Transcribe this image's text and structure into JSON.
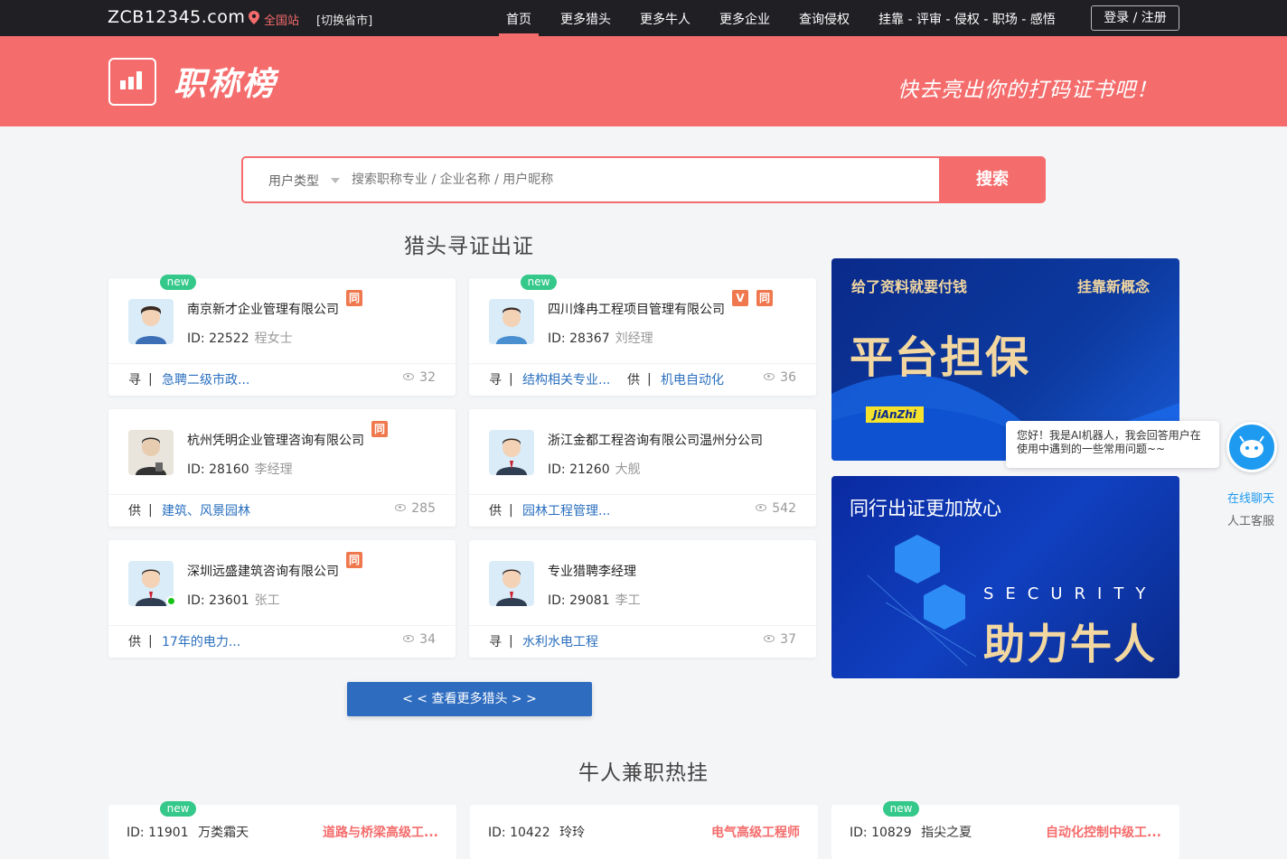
{
  "header": {
    "site_name": "ZCB12345.com",
    "location": "全国站",
    "switch_label": "[切换省市]",
    "nav": [
      "首页",
      "更多猎头",
      "更多牛人",
      "更多企业",
      "查询侵权",
      "挂靠 - 评审 - 侵权 - 职场 - 感悟"
    ],
    "login_label": "登录 / 注册"
  },
  "banner": {
    "logo_text": "职称榜",
    "slogan": "快去亮出你的打码证书吧！"
  },
  "search": {
    "user_type_label": "用户类型",
    "placeholder": "搜索职称专业 / 企业名称 / 用户昵称",
    "button_label": "搜索"
  },
  "headhunter_section": {
    "title": "猎头寻证出证",
    "cards": [
      {
        "company": "南京新才企业管理有限公司",
        "id": "ID: 22522",
        "name": "程女士",
        "new": "new",
        "tags": [
          "同"
        ],
        "f1_type": "寻",
        "f1_text": "急聘二级市政...",
        "f2_type": "",
        "f2_text": "",
        "views": "32"
      },
      {
        "company": "四川烽冉工程项目管理有限公司",
        "id": "ID: 28367",
        "name": "刘经理",
        "new": "new",
        "tags": [
          "V",
          "同"
        ],
        "f1_type": "寻",
        "f1_text": "结构相关专业...",
        "f2_type": "供",
        "f2_text": "机电自动化",
        "views": "36"
      },
      {
        "company": "杭州凭明企业管理咨询有限公司",
        "id": "ID: 28160",
        "name": "李经理",
        "new": "",
        "tags": [
          "同"
        ],
        "f1_type": "供",
        "f1_text": "建筑、风景园林",
        "f2_type": "",
        "f2_text": "",
        "views": "285"
      },
      {
        "company": "浙江金都工程咨询有限公司温州分公司",
        "id": "ID: 21260",
        "name": "大舰",
        "new": "",
        "tags": [],
        "f1_type": "供",
        "f1_text": "园林工程管理...",
        "f2_type": "",
        "f2_text": "",
        "views": "542"
      },
      {
        "company": "深圳远盛建筑咨询有限公司",
        "id": "ID: 23601",
        "name": "张工",
        "new": "",
        "tags": [
          "同"
        ],
        "f1_type": "供",
        "f1_text": "17年的电力...",
        "f2_type": "",
        "f2_text": "",
        "views": "34"
      },
      {
        "company": "专业猎聘李经理",
        "id": "ID: 29081",
        "name": "李工",
        "new": "",
        "tags": [],
        "f1_type": "寻",
        "f1_text": "水利水电工程",
        "f2_type": "",
        "f2_text": "",
        "views": "37"
      }
    ],
    "more_label": "< < 查看更多猎头 > >"
  },
  "ads": {
    "ad1_top_left": "给了资料就要付钱",
    "ad1_top_right": "挂靠新概念",
    "ad1_main": "平台担保",
    "ad1_brand": "JiAnZhi",
    "ad2_top": "同行出证更加放心",
    "ad2_sub": "SECURITY",
    "ad2_main": "助力牛人"
  },
  "chat": {
    "bubble_text": "您好！我是AI机器人，我会回答用户在使用中遇到的一些常用问题~~",
    "online_label": "在线聊天",
    "service_label": "人工客服"
  },
  "talent_section": {
    "title": "牛人兼职热挂",
    "cards": [
      {
        "new": "new",
        "id": "ID: 11901",
        "name": "万类霜天",
        "cert": "道路与桥梁高级工..."
      },
      {
        "new": "",
        "id": "ID: 10422",
        "name": "玲玲",
        "cert": "电气高级工程师"
      },
      {
        "new": "new",
        "id": "ID: 10829",
        "name": "指尖之夏",
        "cert": "自动化控制中级工..."
      }
    ]
  },
  "colors": {
    "brand": "#f56c6c",
    "link": "#2a6fbf",
    "new_badge": "#34c88a",
    "more_button": "#2e6cc0"
  }
}
